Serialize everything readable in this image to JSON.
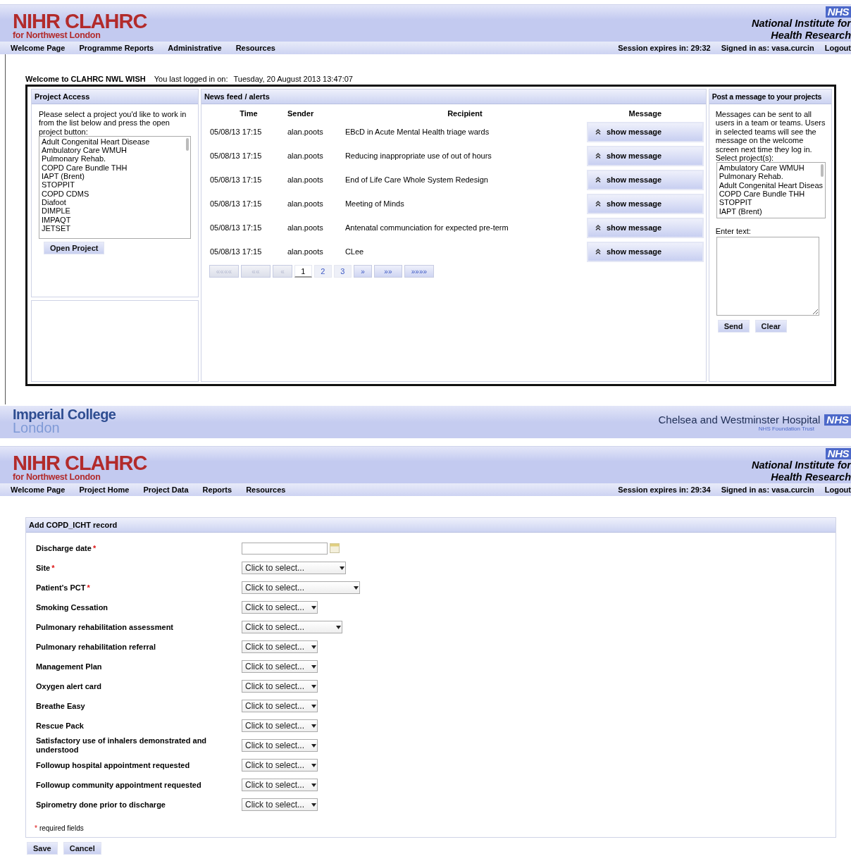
{
  "welcome_screen": {
    "header": {
      "title": "NIHR CLAHRC",
      "subtitle": "for Northwest London",
      "badge": "NHS",
      "institute_line_1": "National Institute for",
      "institute_line_2": "Health Research"
    },
    "nav": {
      "items": [
        "Welcome Page",
        "Programme Reports",
        "Administrative",
        "Resources"
      ],
      "session": "Session expires in: 29:32",
      "signed_in": "Signed in as: vasa.curcin",
      "logout": "Logout"
    },
    "welcome": {
      "title": "Welcome to CLAHRC NWL WISH",
      "last_login_label": "You last logged in on:",
      "last_login": "Tuesday, 20 August 2013 13:47:07"
    },
    "project_access": {
      "title": "Project Access",
      "instructions": "Please select a project you'd like to work in from the list below and press the open project button:",
      "projects": [
        "Adult Congenital Heart Disease",
        "Ambulatory Care WMUH",
        "Pulmonary Rehab.",
        "COPD Care Bundle THH",
        "IAPT (Brent)",
        "STOPPIT",
        "COPD CDMS",
        "Diafoot",
        "DIMPLE",
        "IMPAQT",
        "JETSET"
      ],
      "open_button": "Open Project"
    },
    "news_feed": {
      "title": "News feed / alerts",
      "columns": [
        "Time",
        "Sender",
        "Recipient",
        "Message"
      ],
      "rows": [
        {
          "time": "05/08/13 17:15",
          "sender": "alan.poots",
          "recipient": "EBcD in Acute Mental Health triage wards",
          "action": "show message"
        },
        {
          "time": "05/08/13 17:15",
          "sender": "alan.poots",
          "recipient": "Reducing inappropriate use of out of hours",
          "action": "show message"
        },
        {
          "time": "05/08/13 17:15",
          "sender": "alan.poots",
          "recipient": "End of Life Care Whole System Redesign",
          "action": "show message"
        },
        {
          "time": "05/08/13 17:15",
          "sender": "alan.poots",
          "recipient": "Meeting of Minds",
          "action": "show message"
        },
        {
          "time": "05/08/13 17:15",
          "sender": "alan.poots",
          "recipient": "Antenatal communciation for expected pre-term",
          "action": "show message"
        },
        {
          "time": "05/08/13 17:15",
          "sender": "alan.poots",
          "recipient": "CLee",
          "action": "show message"
        }
      ],
      "pagination": [
        {
          "label": "««««",
          "kind": "arrow",
          "disabled": true,
          "selected": false
        },
        {
          "label": "««",
          "kind": "arrow",
          "disabled": true,
          "selected": false
        },
        {
          "label": "«",
          "kind": "arrow",
          "disabled": true,
          "selected": false
        },
        {
          "label": "1",
          "kind": "page",
          "disabled": false,
          "selected": true
        },
        {
          "label": "2",
          "kind": "page",
          "disabled": false,
          "selected": false
        },
        {
          "label": "3",
          "kind": "page",
          "disabled": false,
          "selected": false
        },
        {
          "label": "»",
          "kind": "arrow",
          "disabled": false,
          "selected": false
        },
        {
          "label": "»»",
          "kind": "arrow",
          "disabled": false,
          "selected": false
        },
        {
          "label": "»»»»",
          "kind": "arrow",
          "disabled": false,
          "selected": false
        }
      ]
    },
    "post_message": {
      "title": "Post a message to your projects",
      "description": "Messages can be sent to all users in a team or teams. Users in selected teams will see the message on the welcome screen next time they log in.",
      "select_label": "Select project(s):",
      "projects": [
        "Ambulatory Care WMUH",
        "Pulmonary Rehab.",
        "Adult Congenital Heart Diseas",
        "COPD Care Bundle THH",
        "STOPPIT",
        "IAPT (Brent)"
      ],
      "text_label": "Enter text:",
      "buttons": [
        "Send",
        "Clear"
      ]
    },
    "footer": {
      "left_line_1": "Imperial College",
      "left_line_2": "London",
      "hospital": "Chelsea and Westminster Hospital",
      "badge": "NHS",
      "trust": "NHS Foundation Trust"
    }
  },
  "record_screen": {
    "header": {
      "title": "NIHR CLAHRC",
      "subtitle": "for Northwest London",
      "badge": "NHS",
      "institute_line_1": "National Institute for",
      "institute_line_2": "Health Research"
    },
    "nav": {
      "items": [
        "Welcome Page",
        "Project Home",
        "Project Data",
        "Reports",
        "Resources"
      ],
      "session": "Session expires in: 29:34",
      "signed_in": "Signed in as: vasa.curcin",
      "logout": "Logout"
    },
    "form": {
      "title": "Add COPD_ICHT record",
      "required_mark": "*",
      "fields": [
        {
          "label": "Discharge date",
          "kind": "date",
          "required": true
        },
        {
          "label": "Site",
          "kind": "select",
          "required": true,
          "value": "Click to select..."
        },
        {
          "label": "Patient's PCT",
          "kind": "select",
          "required": true,
          "value": "Click to select..."
        },
        {
          "label": "Smoking Cessation",
          "kind": "select",
          "required": false,
          "value": "Click to select..."
        },
        {
          "label": "Pulmonary rehabilitation assessment",
          "kind": "select",
          "required": false,
          "value": "Click to select..."
        },
        {
          "label": "Pulmonary rehabilitation referral",
          "kind": "select",
          "required": false,
          "value": "Click to select..."
        },
        {
          "label": "Management Plan",
          "kind": "select",
          "required": false,
          "value": "Click to select..."
        },
        {
          "label": "Oxygen alert card",
          "kind": "select",
          "required": false,
          "value": "Click to select..."
        },
        {
          "label": "Breathe Easy",
          "kind": "select",
          "required": false,
          "value": "Click to select..."
        },
        {
          "label": "Rescue Pack",
          "kind": "select",
          "required": false,
          "value": "Click to select..."
        },
        {
          "label": "Satisfactory use of inhalers demonstrated and understood",
          "kind": "select",
          "required": false,
          "value": "Click to select..."
        },
        {
          "label": "Followup hospital appointment requested",
          "kind": "select",
          "required": false,
          "value": "Click to select..."
        },
        {
          "label": "Followup community appointment requested",
          "kind": "select",
          "required": false,
          "value": "Click to select..."
        },
        {
          "label": "Spirometry done prior to discharge",
          "kind": "select",
          "required": false,
          "value": "Click to select..."
        }
      ],
      "required_note": "required fields",
      "buttons": [
        "Save",
        "Cancel"
      ]
    }
  }
}
